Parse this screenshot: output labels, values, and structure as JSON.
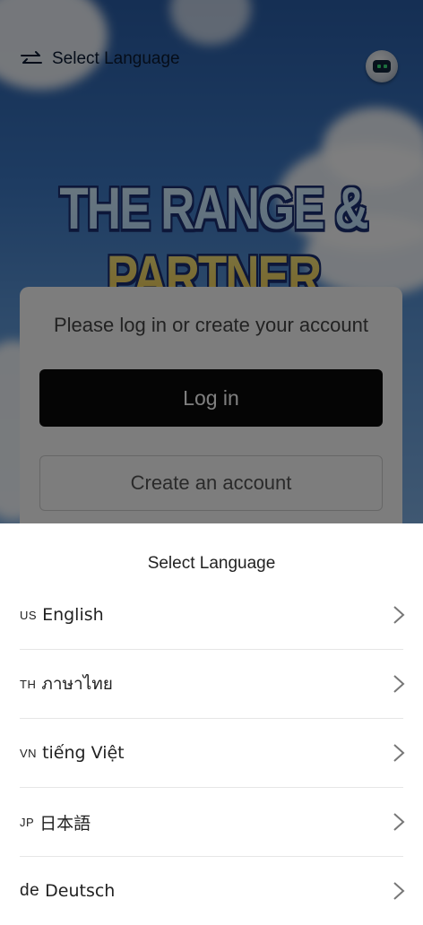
{
  "header": {
    "label": "Select Language",
    "swap_icon": "swap-arrows-icon",
    "avatar_icon": "robot-avatar-icon"
  },
  "brand": {
    "title": "THE RANGE & PARTNER"
  },
  "login_card": {
    "prompt": "Please log in or create your account",
    "login_label": "Log in",
    "create_label": "Create an account"
  },
  "sheet": {
    "title": "Select Language",
    "languages": [
      {
        "code": "US",
        "name": "English"
      },
      {
        "code": "TH",
        "name": "ภาษาไทย"
      },
      {
        "code": "VN",
        "name": "tiếng Việt"
      },
      {
        "code": "JP",
        "name": "日本語"
      },
      {
        "code": "de",
        "name": "Deutsch"
      }
    ],
    "chevron_icon": "chevron-right-icon"
  },
  "colors": {
    "overlay": "#000000",
    "primary_button": "#0a0a0a",
    "brand_outline": "#1b2f73"
  }
}
